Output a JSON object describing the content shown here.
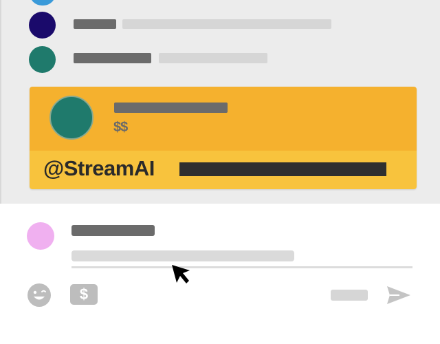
{
  "superchat": {
    "amount": "$$",
    "handle": "@StreamAI"
  },
  "colors": {
    "feed_background": "#ececec",
    "superchat_header": "#f5b12e",
    "superchat_body": "#f8c33d",
    "avatar_blue": "#3a9ad9",
    "avatar_navy": "#1a0a6b",
    "avatar_teal": "#1f7a6c",
    "avatar_pink": "#f0b0f0"
  },
  "icons": {
    "emoji": "emoji-icon",
    "money": "dollar-icon",
    "send": "send-icon",
    "cursor": "mouse-pointer-icon"
  }
}
